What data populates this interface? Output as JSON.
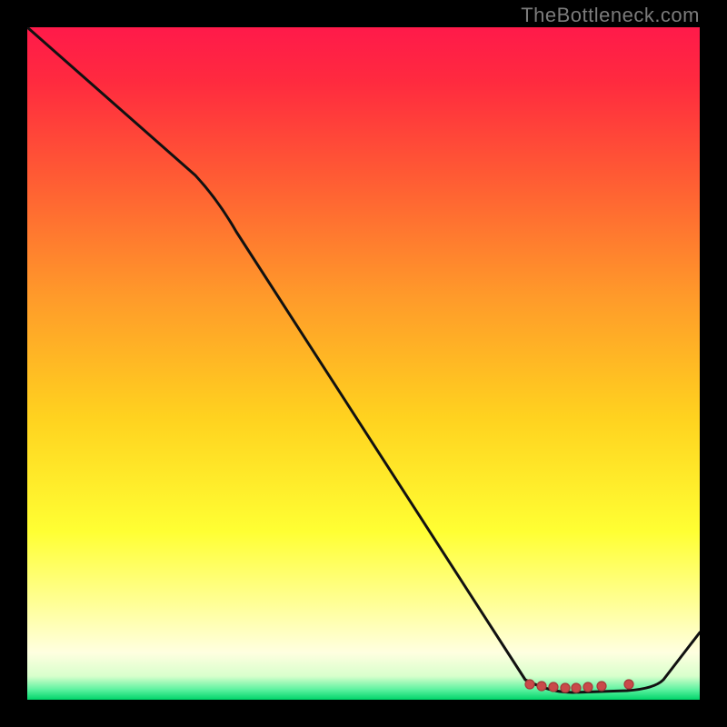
{
  "watermark": "TheBottleneck.com",
  "colors": {
    "page_bg": "#000000",
    "grad_top": "#ff1744",
    "grad_mid_upper": "#ff6a2b",
    "grad_mid": "#ffd500",
    "grad_low": "#ffff66",
    "grad_pale": "#ffffcc",
    "grad_green": "#00e676",
    "line": "#000000",
    "dot_fill": "#c94a4a",
    "dot_stroke": "#b03a3a",
    "watermark": "#7b7b7b"
  },
  "chart_data": {
    "type": "line",
    "title": "",
    "xlabel": "",
    "ylabel": "",
    "xlim": [
      0,
      100
    ],
    "ylim": [
      0,
      100
    ],
    "note": "No axis tick labels are visible; values below are normalized 0–100 along each axis, estimated from pixel positions.",
    "series": [
      {
        "name": "curve",
        "points": [
          {
            "x": 0,
            "y": 100
          },
          {
            "x": 25,
            "y": 78
          },
          {
            "x": 30,
            "y": 72
          },
          {
            "x": 74,
            "y": 3
          },
          {
            "x": 80,
            "y": 1
          },
          {
            "x": 90,
            "y": 1
          },
          {
            "x": 93,
            "y": 2
          },
          {
            "x": 100,
            "y": 10
          }
        ]
      }
    ],
    "optimal_markers": {
      "name": "optimal-range",
      "points": [
        {
          "x": 75,
          "y": 2
        },
        {
          "x": 77,
          "y": 2
        },
        {
          "x": 79,
          "y": 2
        },
        {
          "x": 81,
          "y": 2
        },
        {
          "x": 82.5,
          "y": 2
        },
        {
          "x": 84,
          "y": 2
        },
        {
          "x": 86,
          "y": 2
        },
        {
          "x": 90,
          "y": 2
        }
      ]
    }
  }
}
